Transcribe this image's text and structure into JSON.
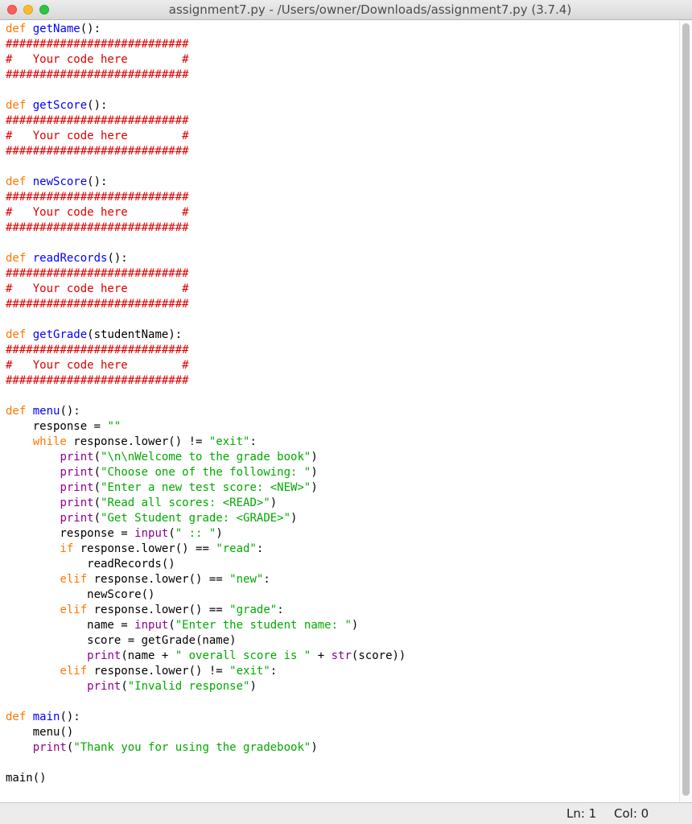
{
  "window": {
    "title": "assignment7.py - /Users/owner/Downloads/assignment7.py (3.7.4)"
  },
  "status": {
    "line": "Ln: 1",
    "column": "Col: 0"
  },
  "colors": {
    "keyword": "#ff7700",
    "defname": "#0000ff",
    "builtin": "#900090",
    "string": "#00aa00",
    "comment": "#dd0000"
  },
  "code_lines": [
    [
      [
        "keyword",
        "def"
      ],
      [
        "plain",
        " "
      ],
      [
        "defname",
        "getName"
      ],
      [
        "plain",
        "():"
      ]
    ],
    [
      [
        "comment",
        "###########################"
      ]
    ],
    [
      [
        "comment",
        "#   Your code here        #"
      ]
    ],
    [
      [
        "comment",
        "###########################"
      ]
    ],
    [],
    [
      [
        "keyword",
        "def"
      ],
      [
        "plain",
        " "
      ],
      [
        "defname",
        "getScore"
      ],
      [
        "plain",
        "():"
      ]
    ],
    [
      [
        "comment",
        "###########################"
      ]
    ],
    [
      [
        "comment",
        "#   Your code here        #"
      ]
    ],
    [
      [
        "comment",
        "###########################"
      ]
    ],
    [],
    [
      [
        "keyword",
        "def"
      ],
      [
        "plain",
        " "
      ],
      [
        "defname",
        "newScore"
      ],
      [
        "plain",
        "():"
      ]
    ],
    [
      [
        "comment",
        "###########################"
      ]
    ],
    [
      [
        "comment",
        "#   Your code here        #"
      ]
    ],
    [
      [
        "comment",
        "###########################"
      ]
    ],
    [],
    [
      [
        "keyword",
        "def"
      ],
      [
        "plain",
        " "
      ],
      [
        "defname",
        "readRecords"
      ],
      [
        "plain",
        "():"
      ]
    ],
    [
      [
        "comment",
        "###########################"
      ]
    ],
    [
      [
        "comment",
        "#   Your code here        #"
      ]
    ],
    [
      [
        "comment",
        "###########################"
      ]
    ],
    [],
    [
      [
        "keyword",
        "def"
      ],
      [
        "plain",
        " "
      ],
      [
        "defname",
        "getGrade"
      ],
      [
        "plain",
        "(studentName):"
      ]
    ],
    [
      [
        "comment",
        "###########################"
      ]
    ],
    [
      [
        "comment",
        "#   Your code here        #"
      ]
    ],
    [
      [
        "comment",
        "###########################"
      ]
    ],
    [],
    [
      [
        "keyword",
        "def"
      ],
      [
        "plain",
        " "
      ],
      [
        "defname",
        "menu"
      ],
      [
        "plain",
        "():"
      ]
    ],
    [
      [
        "plain",
        "    response = "
      ],
      [
        "string",
        "\"\""
      ]
    ],
    [
      [
        "plain",
        "    "
      ],
      [
        "keyword",
        "while"
      ],
      [
        "plain",
        " response.lower() != "
      ],
      [
        "string",
        "\"exit\""
      ],
      [
        "plain",
        ":"
      ]
    ],
    [
      [
        "plain",
        "        "
      ],
      [
        "builtin",
        "print"
      ],
      [
        "plain",
        "("
      ],
      [
        "string",
        "\"\\n\\nWelcome to the grade book\""
      ],
      [
        "plain",
        ")"
      ]
    ],
    [
      [
        "plain",
        "        "
      ],
      [
        "builtin",
        "print"
      ],
      [
        "plain",
        "("
      ],
      [
        "string",
        "\"Choose one of the following: \""
      ],
      [
        "plain",
        ")"
      ]
    ],
    [
      [
        "plain",
        "        "
      ],
      [
        "builtin",
        "print"
      ],
      [
        "plain",
        "("
      ],
      [
        "string",
        "\"Enter a new test score: <NEW>\""
      ],
      [
        "plain",
        ")"
      ]
    ],
    [
      [
        "plain",
        "        "
      ],
      [
        "builtin",
        "print"
      ],
      [
        "plain",
        "("
      ],
      [
        "string",
        "\"Read all scores: <READ>\""
      ],
      [
        "plain",
        ")"
      ]
    ],
    [
      [
        "plain",
        "        "
      ],
      [
        "builtin",
        "print"
      ],
      [
        "plain",
        "("
      ],
      [
        "string",
        "\"Get Student grade: <GRADE>\""
      ],
      [
        "plain",
        ")"
      ]
    ],
    [
      [
        "plain",
        "        response = "
      ],
      [
        "builtin",
        "input"
      ],
      [
        "plain",
        "("
      ],
      [
        "string",
        "\" :: \""
      ],
      [
        "plain",
        ")"
      ]
    ],
    [
      [
        "plain",
        "        "
      ],
      [
        "keyword",
        "if"
      ],
      [
        "plain",
        " response.lower() == "
      ],
      [
        "string",
        "\"read\""
      ],
      [
        "plain",
        ":"
      ]
    ],
    [
      [
        "plain",
        "            readRecords()"
      ]
    ],
    [
      [
        "plain",
        "        "
      ],
      [
        "keyword",
        "elif"
      ],
      [
        "plain",
        " response.lower() == "
      ],
      [
        "string",
        "\"new\""
      ],
      [
        "plain",
        ":"
      ]
    ],
    [
      [
        "plain",
        "            newScore()"
      ]
    ],
    [
      [
        "plain",
        "        "
      ],
      [
        "keyword",
        "elif"
      ],
      [
        "plain",
        " response.lower() == "
      ],
      [
        "string",
        "\"grade\""
      ],
      [
        "plain",
        ":"
      ]
    ],
    [
      [
        "plain",
        "            name = "
      ],
      [
        "builtin",
        "input"
      ],
      [
        "plain",
        "("
      ],
      [
        "string",
        "\"Enter the student name: \""
      ],
      [
        "plain",
        ")"
      ]
    ],
    [
      [
        "plain",
        "            score = getGrade(name)"
      ]
    ],
    [
      [
        "plain",
        "            "
      ],
      [
        "builtin",
        "print"
      ],
      [
        "plain",
        "(name + "
      ],
      [
        "string",
        "\" overall score is \""
      ],
      [
        "plain",
        " + "
      ],
      [
        "builtin",
        "str"
      ],
      [
        "plain",
        "(score))"
      ]
    ],
    [
      [
        "plain",
        "        "
      ],
      [
        "keyword",
        "elif"
      ],
      [
        "plain",
        " response.lower() != "
      ],
      [
        "string",
        "\"exit\""
      ],
      [
        "plain",
        ":"
      ]
    ],
    [
      [
        "plain",
        "            "
      ],
      [
        "builtin",
        "print"
      ],
      [
        "plain",
        "("
      ],
      [
        "string",
        "\"Invalid response\""
      ],
      [
        "plain",
        ")"
      ]
    ],
    [],
    [
      [
        "keyword",
        "def"
      ],
      [
        "plain",
        " "
      ],
      [
        "defname",
        "main"
      ],
      [
        "plain",
        "():"
      ]
    ],
    [
      [
        "plain",
        "    menu()"
      ]
    ],
    [
      [
        "plain",
        "    "
      ],
      [
        "builtin",
        "print"
      ],
      [
        "plain",
        "("
      ],
      [
        "string",
        "\"Thank you for using the gradebook\""
      ],
      [
        "plain",
        ")"
      ]
    ],
    [],
    [
      [
        "plain",
        "main()"
      ]
    ]
  ]
}
